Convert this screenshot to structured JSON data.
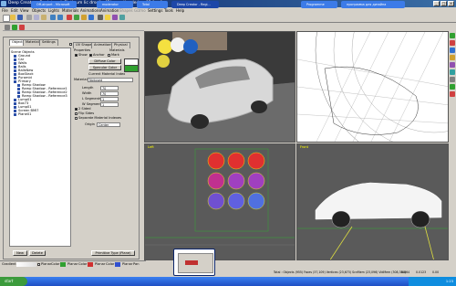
{
  "window": {
    "title": "Deep Creator - Registered: Platinum lic drsoft - [F:\\game\\loader\\mx05.fore]",
    "controls": {
      "minimize": "_",
      "maximize": "□",
      "close": "x"
    }
  },
  "menu": [
    "File",
    "Edit",
    "View",
    "Objects",
    "Lights",
    "Materials",
    "Animations",
    "Animation",
    "Shapes",
    "Gizmo",
    "Settings",
    "Tools",
    "Help"
  ],
  "left_panel": {
    "tabs": [
      "Objects",
      "Materials",
      "Settings"
    ],
    "tree": [
      "Scene Objects",
      "Ground",
      "Car",
      "Walls",
      "Balls",
      "BallsNew",
      "BoxStack",
      "Pyramid",
      "Primary",
      "Ramp Shadow",
      "Ramp Shadow - Reference1",
      "Ramp Shadow - Reference2",
      "Ramp Shadow - Reference3",
      "Lump01",
      "Box73",
      "Lump01",
      "Screen BMI7",
      "Plane01"
    ],
    "grid_checkbox": "Grid",
    "buttons": {
      "new": "New",
      "delete": "Delete",
      "primitive": "Primitive Type (Plane)"
    }
  },
  "properties": {
    "tabs": [
      "UV Shape",
      "Animations",
      "Physical"
    ],
    "section_properties": "Properties",
    "section_materials": "Materials",
    "checks": {
      "show": "Show",
      "anchor": "Anchor",
      "mark": "Mark"
    },
    "diffuse": "Diffuse Color",
    "specular": "Specular Color",
    "material_index": "Current Material Index",
    "material_label": "Material",
    "material_value": "Notused",
    "length_label": "Length",
    "length_value": "70",
    "width_label": "Width",
    "width_value": "70",
    "lseg_label": "L Segments",
    "lseg_value": "1",
    "wseg_label": "W Segments",
    "wseg_value": "1",
    "chk_sided": "2 Sided",
    "chk_flip": "Flip Sides",
    "chk_sep": "Separate Material Indexes",
    "origin_label": "Origin",
    "origin_value": "Center"
  },
  "viewports": {
    "persp": "",
    "top": "",
    "left": "Left",
    "front": "Front"
  },
  "bottom_toolbar": {
    "gradient": "Gradient",
    "planar": "Planar",
    "color": "Color",
    "pan": "Pan"
  },
  "status": {
    "text": "Total : Objects (955) Faces (37,109) Vertices (23,673) ScnMem (23,096) VidMem (308,384)",
    "zoom": "0.864",
    "coord1": "0.0123",
    "coord2": "0.00"
  },
  "taskbar": {
    "start": "start",
    "tasks": [
      "Off-airport - Microsoft",
      "moderator",
      "Total",
      "Deep Creator - Regi...",
      "Programme",
      "программа для дизайна"
    ],
    "clock": "1:23"
  },
  "colors": {
    "accent": "#0a246a",
    "viewport_bg": "#505050",
    "wire_bg": "#ffffff",
    "diffuse": "#ffffff",
    "specular": "#2fa02f"
  }
}
